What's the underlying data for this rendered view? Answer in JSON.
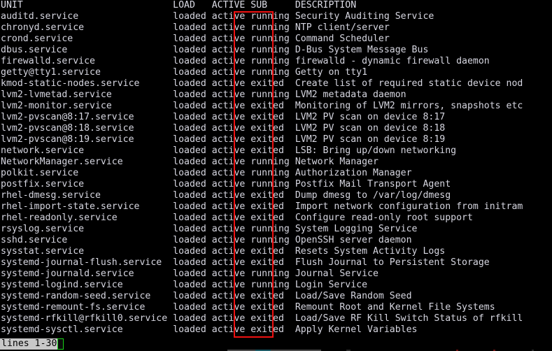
{
  "terminal": {
    "app": "systemctl list-units pager",
    "background_color": "#000000",
    "foreground_color": "#d6d6e0",
    "columns_header": {
      "unit": "UNIT",
      "load": "LOAD",
      "active": "ACTIVE",
      "sub": "SUB",
      "description": "DESCRIPTION"
    },
    "header_line": "UNIT                           LOAD   ACTIVE SUB     DESCRIPTION",
    "rows": [
      {
        "unit": "auditd.service",
        "load": "loaded",
        "active": "active",
        "sub": "running",
        "description": "Security Auditing Service"
      },
      {
        "unit": "chronyd.service",
        "load": "loaded",
        "active": "active",
        "sub": "running",
        "description": "NTP client/server"
      },
      {
        "unit": "crond.service",
        "load": "loaded",
        "active": "active",
        "sub": "running",
        "description": "Command Scheduler"
      },
      {
        "unit": "dbus.service",
        "load": "loaded",
        "active": "active",
        "sub": "running",
        "description": "D-Bus System Message Bus"
      },
      {
        "unit": "firewalld.service",
        "load": "loaded",
        "active": "active",
        "sub": "running",
        "description": "firewalld - dynamic firewall daemon"
      },
      {
        "unit": "getty@tty1.service",
        "load": "loaded",
        "active": "active",
        "sub": "running",
        "description": "Getty on tty1"
      },
      {
        "unit": "kmod-static-nodes.service",
        "load": "loaded",
        "active": "active",
        "sub": "exited",
        "description": "Create list of required static device nod"
      },
      {
        "unit": "lvm2-lvmetad.service",
        "load": "loaded",
        "active": "active",
        "sub": "running",
        "description": "LVM2 metadata daemon"
      },
      {
        "unit": "lvm2-monitor.service",
        "load": "loaded",
        "active": "active",
        "sub": "exited",
        "description": "Monitoring of LVM2 mirrors, snapshots etc"
      },
      {
        "unit": "lvm2-pvscan@8:17.service",
        "load": "loaded",
        "active": "active",
        "sub": "exited",
        "description": "LVM2 PV scan on device 8:17"
      },
      {
        "unit": "lvm2-pvscan@8:18.service",
        "load": "loaded",
        "active": "active",
        "sub": "exited",
        "description": "LVM2 PV scan on device 8:18"
      },
      {
        "unit": "lvm2-pvscan@8:19.service",
        "load": "loaded",
        "active": "active",
        "sub": "exited",
        "description": "LVM2 PV scan on device 8:19"
      },
      {
        "unit": "network.service",
        "load": "loaded",
        "active": "active",
        "sub": "exited",
        "description": "LSB: Bring up/down networking"
      },
      {
        "unit": "NetworkManager.service",
        "load": "loaded",
        "active": "active",
        "sub": "running",
        "description": "Network Manager"
      },
      {
        "unit": "polkit.service",
        "load": "loaded",
        "active": "active",
        "sub": "running",
        "description": "Authorization Manager"
      },
      {
        "unit": "postfix.service",
        "load": "loaded",
        "active": "active",
        "sub": "running",
        "description": "Postfix Mail Transport Agent"
      },
      {
        "unit": "rhel-dmesg.service",
        "load": "loaded",
        "active": "active",
        "sub": "exited",
        "description": "Dump dmesg to /var/log/dmesg"
      },
      {
        "unit": "rhel-import-state.service",
        "load": "loaded",
        "active": "active",
        "sub": "exited",
        "description": "Import network configuration from initram"
      },
      {
        "unit": "rhel-readonly.service",
        "load": "loaded",
        "active": "active",
        "sub": "exited",
        "description": "Configure read-only root support"
      },
      {
        "unit": "rsyslog.service",
        "load": "loaded",
        "active": "active",
        "sub": "running",
        "description": "System Logging Service"
      },
      {
        "unit": "sshd.service",
        "load": "loaded",
        "active": "active",
        "sub": "running",
        "description": "OpenSSH server daemon"
      },
      {
        "unit": "sysstat.service",
        "load": "loaded",
        "active": "active",
        "sub": "exited",
        "description": "Resets System Activity Logs"
      },
      {
        "unit": "systemd-journal-flush.service",
        "load": "loaded",
        "active": "active",
        "sub": "exited",
        "description": "Flush Journal to Persistent Storage"
      },
      {
        "unit": "systemd-journald.service",
        "load": "loaded",
        "active": "active",
        "sub": "running",
        "description": "Journal Service"
      },
      {
        "unit": "systemd-logind.service",
        "load": "loaded",
        "active": "active",
        "sub": "running",
        "description": "Login Service"
      },
      {
        "unit": "systemd-random-seed.service",
        "load": "loaded",
        "active": "active",
        "sub": "exited",
        "description": "Load/Save Random Seed"
      },
      {
        "unit": "systemd-remount-fs.service",
        "load": "loaded",
        "active": "active",
        "sub": "exited",
        "description": "Remount Root and Kernel File Systems"
      },
      {
        "unit": "systemd-rfkill@rfkill0.service",
        "load": "loaded",
        "active": "active",
        "sub": "exited",
        "description": "Load/Save RF Kill Switch Status of rfkill"
      },
      {
        "unit": "systemd-sysctl.service",
        "load": "loaded",
        "active": "active",
        "sub": "exited",
        "description": "Apply Kernel Variables"
      }
    ],
    "status_bar": {
      "text": "lines 1-30",
      "background_color": "#c8c8c8",
      "foreground_color": "#000000",
      "cursor_color": "#19d219"
    },
    "annotation": {
      "type": "rectangle-highlight",
      "target_column": "ACTIVE",
      "color": "#ee1111"
    }
  }
}
